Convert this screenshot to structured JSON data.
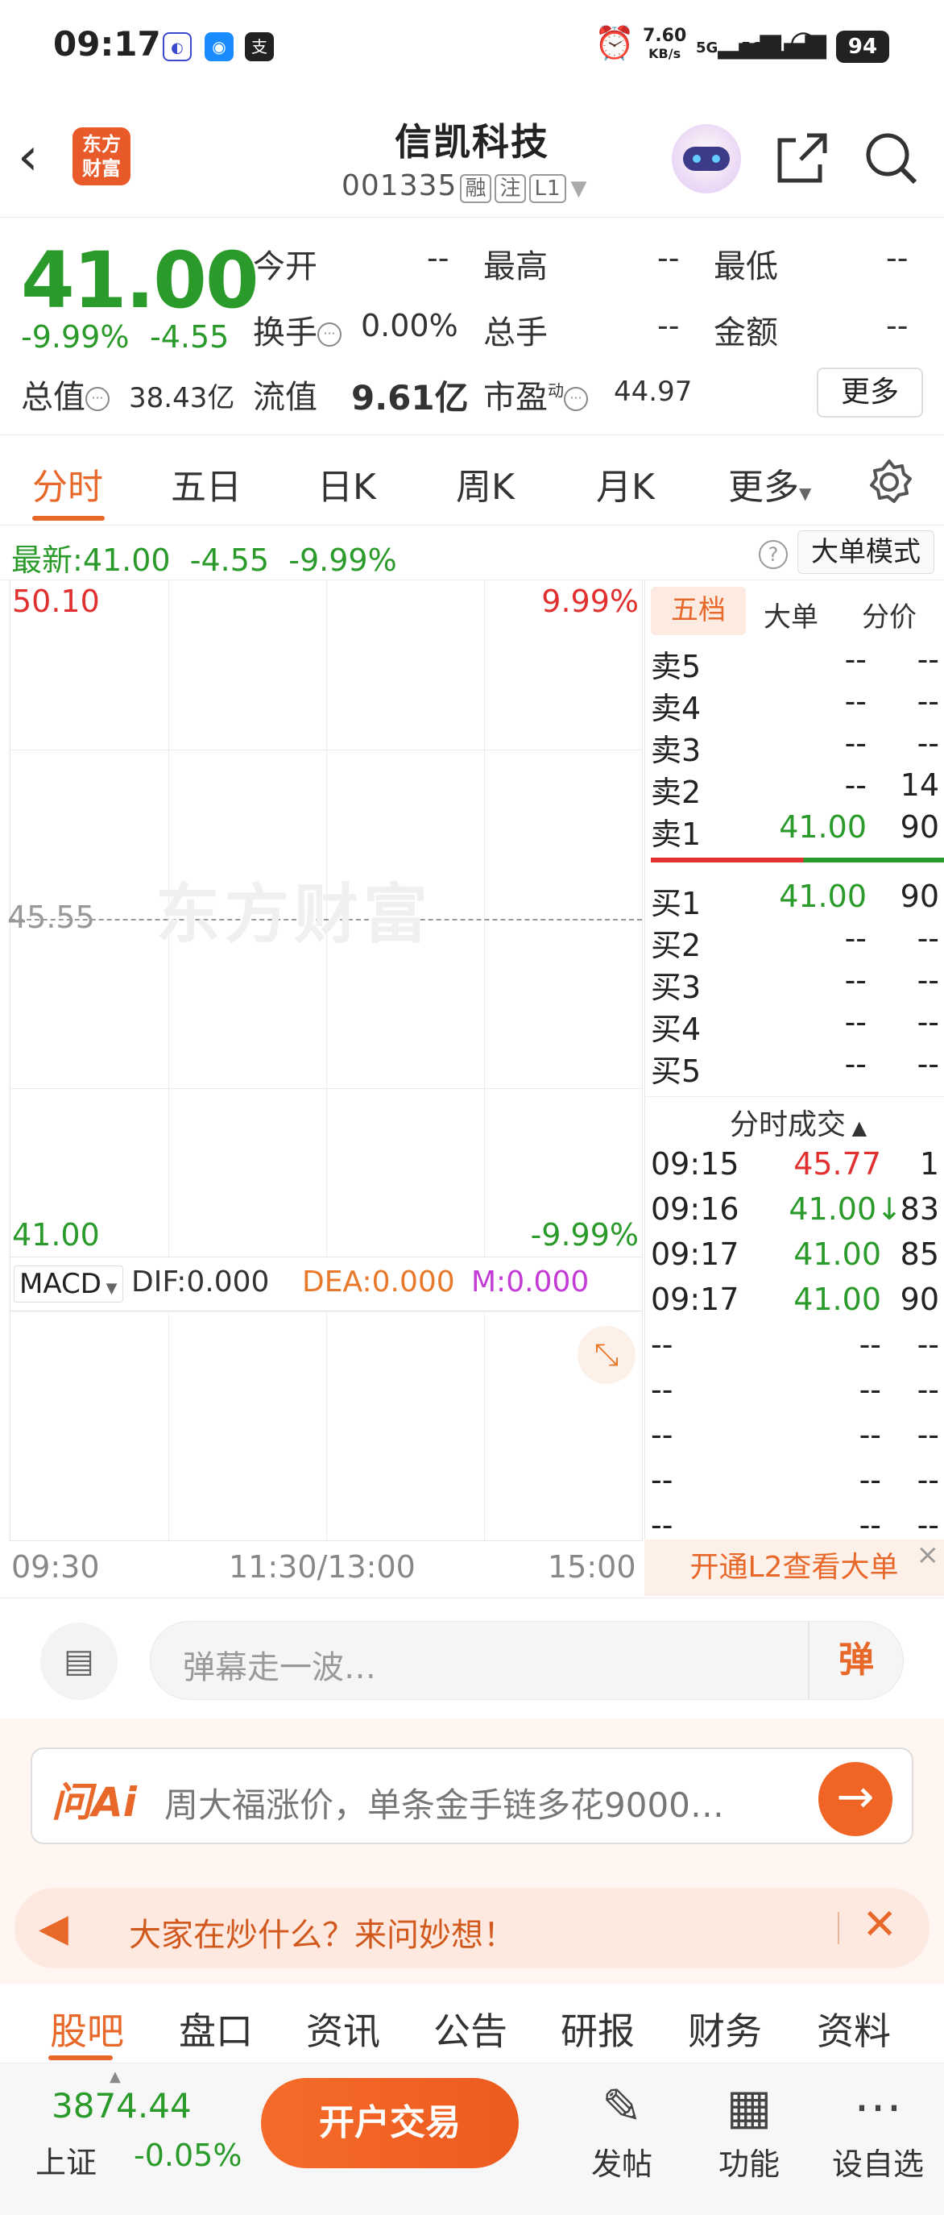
{
  "status": {
    "time": "09:17",
    "net_speed_top": "7.60",
    "net_speed_unit": "KB/s",
    "signal1": "5G",
    "signal2": "5G",
    "battery": "94"
  },
  "header": {
    "logo_line1": "东方",
    "logo_line2": "财富",
    "name": "信凯科技",
    "code": "001335",
    "tags": [
      "融",
      "注",
      "L1"
    ]
  },
  "quote": {
    "price": "41.00",
    "change_pct": "-9.99%",
    "change": "-4.55",
    "open_label": "今开",
    "open": "--",
    "high_label": "最高",
    "high": "--",
    "low_label": "最低",
    "low": "--",
    "turnover_label": "换手",
    "turnover": "0.00%",
    "volume_label": "总手",
    "volume": "--",
    "amount_label": "金额",
    "amount": "--",
    "mktcap_label": "总值",
    "mktcap": "38.43亿",
    "float_label": "流值",
    "float": "9.61亿",
    "pe_label": "市盈",
    "pe_sup": "动",
    "pe": "44.97",
    "more": "更多"
  },
  "chart_tabs": [
    "分时",
    "五日",
    "日K",
    "周K",
    "月K",
    "更多"
  ],
  "latest": {
    "label": "最新:",
    "price": "41.00",
    "change": "-4.55",
    "pct": "-9.99%",
    "help": "?",
    "mode": "大单模式"
  },
  "chart": {
    "top_price": "50.10",
    "top_pct": "9.99%",
    "mid_price": "45.55",
    "bottom_price": "41.00",
    "bottom_pct": "-9.99%",
    "watermark": "东方财富",
    "macd_sel": "MACD",
    "dif": "DIF:0.000",
    "dea": "DEA:0.000",
    "m": "M:0.000",
    "times": [
      "09:30",
      "11:30/13:00",
      "15:00"
    ]
  },
  "book": {
    "tabs": [
      "五档",
      "大单",
      "分价"
    ],
    "asks": [
      {
        "l": "卖5",
        "p": "--",
        "v": "--"
      },
      {
        "l": "卖4",
        "p": "--",
        "v": "--"
      },
      {
        "l": "卖3",
        "p": "--",
        "v": "--"
      },
      {
        "l": "卖2",
        "p": "--",
        "v": "14"
      },
      {
        "l": "卖1",
        "p": "41.00",
        "v": "90"
      }
    ],
    "bids": [
      {
        "l": "买1",
        "p": "41.00",
        "v": "90"
      },
      {
        "l": "买2",
        "p": "--",
        "v": "--"
      },
      {
        "l": "买3",
        "p": "--",
        "v": "--"
      },
      {
        "l": "买4",
        "p": "--",
        "v": "--"
      },
      {
        "l": "买5",
        "p": "--",
        "v": "--"
      }
    ],
    "trades_title": "分时成交",
    "trades": [
      {
        "t": "09:15",
        "p": "45.77",
        "v": "1"
      },
      {
        "t": "09:16",
        "p": "41.00↓",
        "v": "83"
      },
      {
        "t": "09:17",
        "p": "41.00",
        "v": "85"
      },
      {
        "t": "09:17",
        "p": "41.00",
        "v": "90"
      },
      {
        "t": "--",
        "p": "--",
        "v": "--"
      },
      {
        "t": "--",
        "p": "--",
        "v": "--"
      },
      {
        "t": "--",
        "p": "--",
        "v": "--"
      },
      {
        "t": "--",
        "p": "--",
        "v": "--"
      },
      {
        "t": "--",
        "p": "--",
        "v": "--"
      }
    ],
    "l2": "开通L2查看大单"
  },
  "danmu": {
    "placeholder": "弹幕走一波…",
    "btn": "弹"
  },
  "ai": {
    "logo": "问Ai",
    "text": "周大福涨价，单条金手链多花9000…",
    "hot": "大家在炒什么？来问妙想！"
  },
  "bottom_tabs": [
    "股吧",
    "盘口",
    "资讯",
    "公告",
    "研报",
    "财务",
    "资料"
  ],
  "nav": {
    "index_value": "3874.44",
    "index_name": "上证",
    "index_change": "-0.05%",
    "trade": "开户交易",
    "post": "发帖",
    "func": "功能",
    "watch": "设自选"
  }
}
